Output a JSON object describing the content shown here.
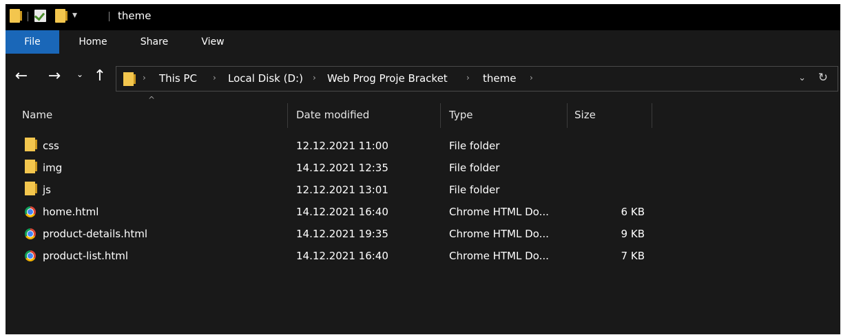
{
  "window": {
    "title": "theme"
  },
  "quick_access": {
    "icons": [
      "folder-icon",
      "properties-icon",
      "new-folder-icon"
    ],
    "dropdown_glyph": "▾"
  },
  "ribbon": {
    "tabs": [
      {
        "label": "File",
        "active": true
      },
      {
        "label": "Home"
      },
      {
        "label": "Share"
      },
      {
        "label": "View"
      }
    ]
  },
  "nav": {
    "back_glyph": "←",
    "forward_glyph": "→",
    "recent_glyph": "⌄",
    "up_glyph": "↑"
  },
  "address": {
    "crumbs": [
      "This PC",
      "Local Disk (D:)",
      "Web Prog Proje Bracket",
      "theme"
    ],
    "separator": "›",
    "dropdown_glyph": "⌄",
    "refresh_glyph": "↻"
  },
  "columns": {
    "name": "Name",
    "date": "Date modified",
    "type": "Type",
    "size": "Size",
    "sort_glyph": "^"
  },
  "files": [
    {
      "icon": "folder-icon",
      "name": "css",
      "date": "12.12.2021 11:00",
      "type": "File folder",
      "size": ""
    },
    {
      "icon": "folder-icon",
      "name": "img",
      "date": "14.12.2021 12:35",
      "type": "File folder",
      "size": ""
    },
    {
      "icon": "folder-icon",
      "name": "js",
      "date": "12.12.2021 13:01",
      "type": "File folder",
      "size": ""
    },
    {
      "icon": "chrome-html-icon",
      "name": "home.html",
      "date": "14.12.2021 16:40",
      "type": "Chrome HTML Do...",
      "size": "6 KB"
    },
    {
      "icon": "chrome-html-icon",
      "name": "product-details.html",
      "date": "14.12.2021 19:35",
      "type": "Chrome HTML Do...",
      "size": "9 KB"
    },
    {
      "icon": "chrome-html-icon",
      "name": "product-list.html",
      "date": "14.12.2021 16:40",
      "type": "Chrome HTML Do...",
      "size": "7 KB"
    }
  ],
  "colors": {
    "background": "#191919",
    "titlebar": "#000000",
    "file_tab": "#1a67b8",
    "folder": "#f3c64e",
    "text": "#ffffff"
  }
}
